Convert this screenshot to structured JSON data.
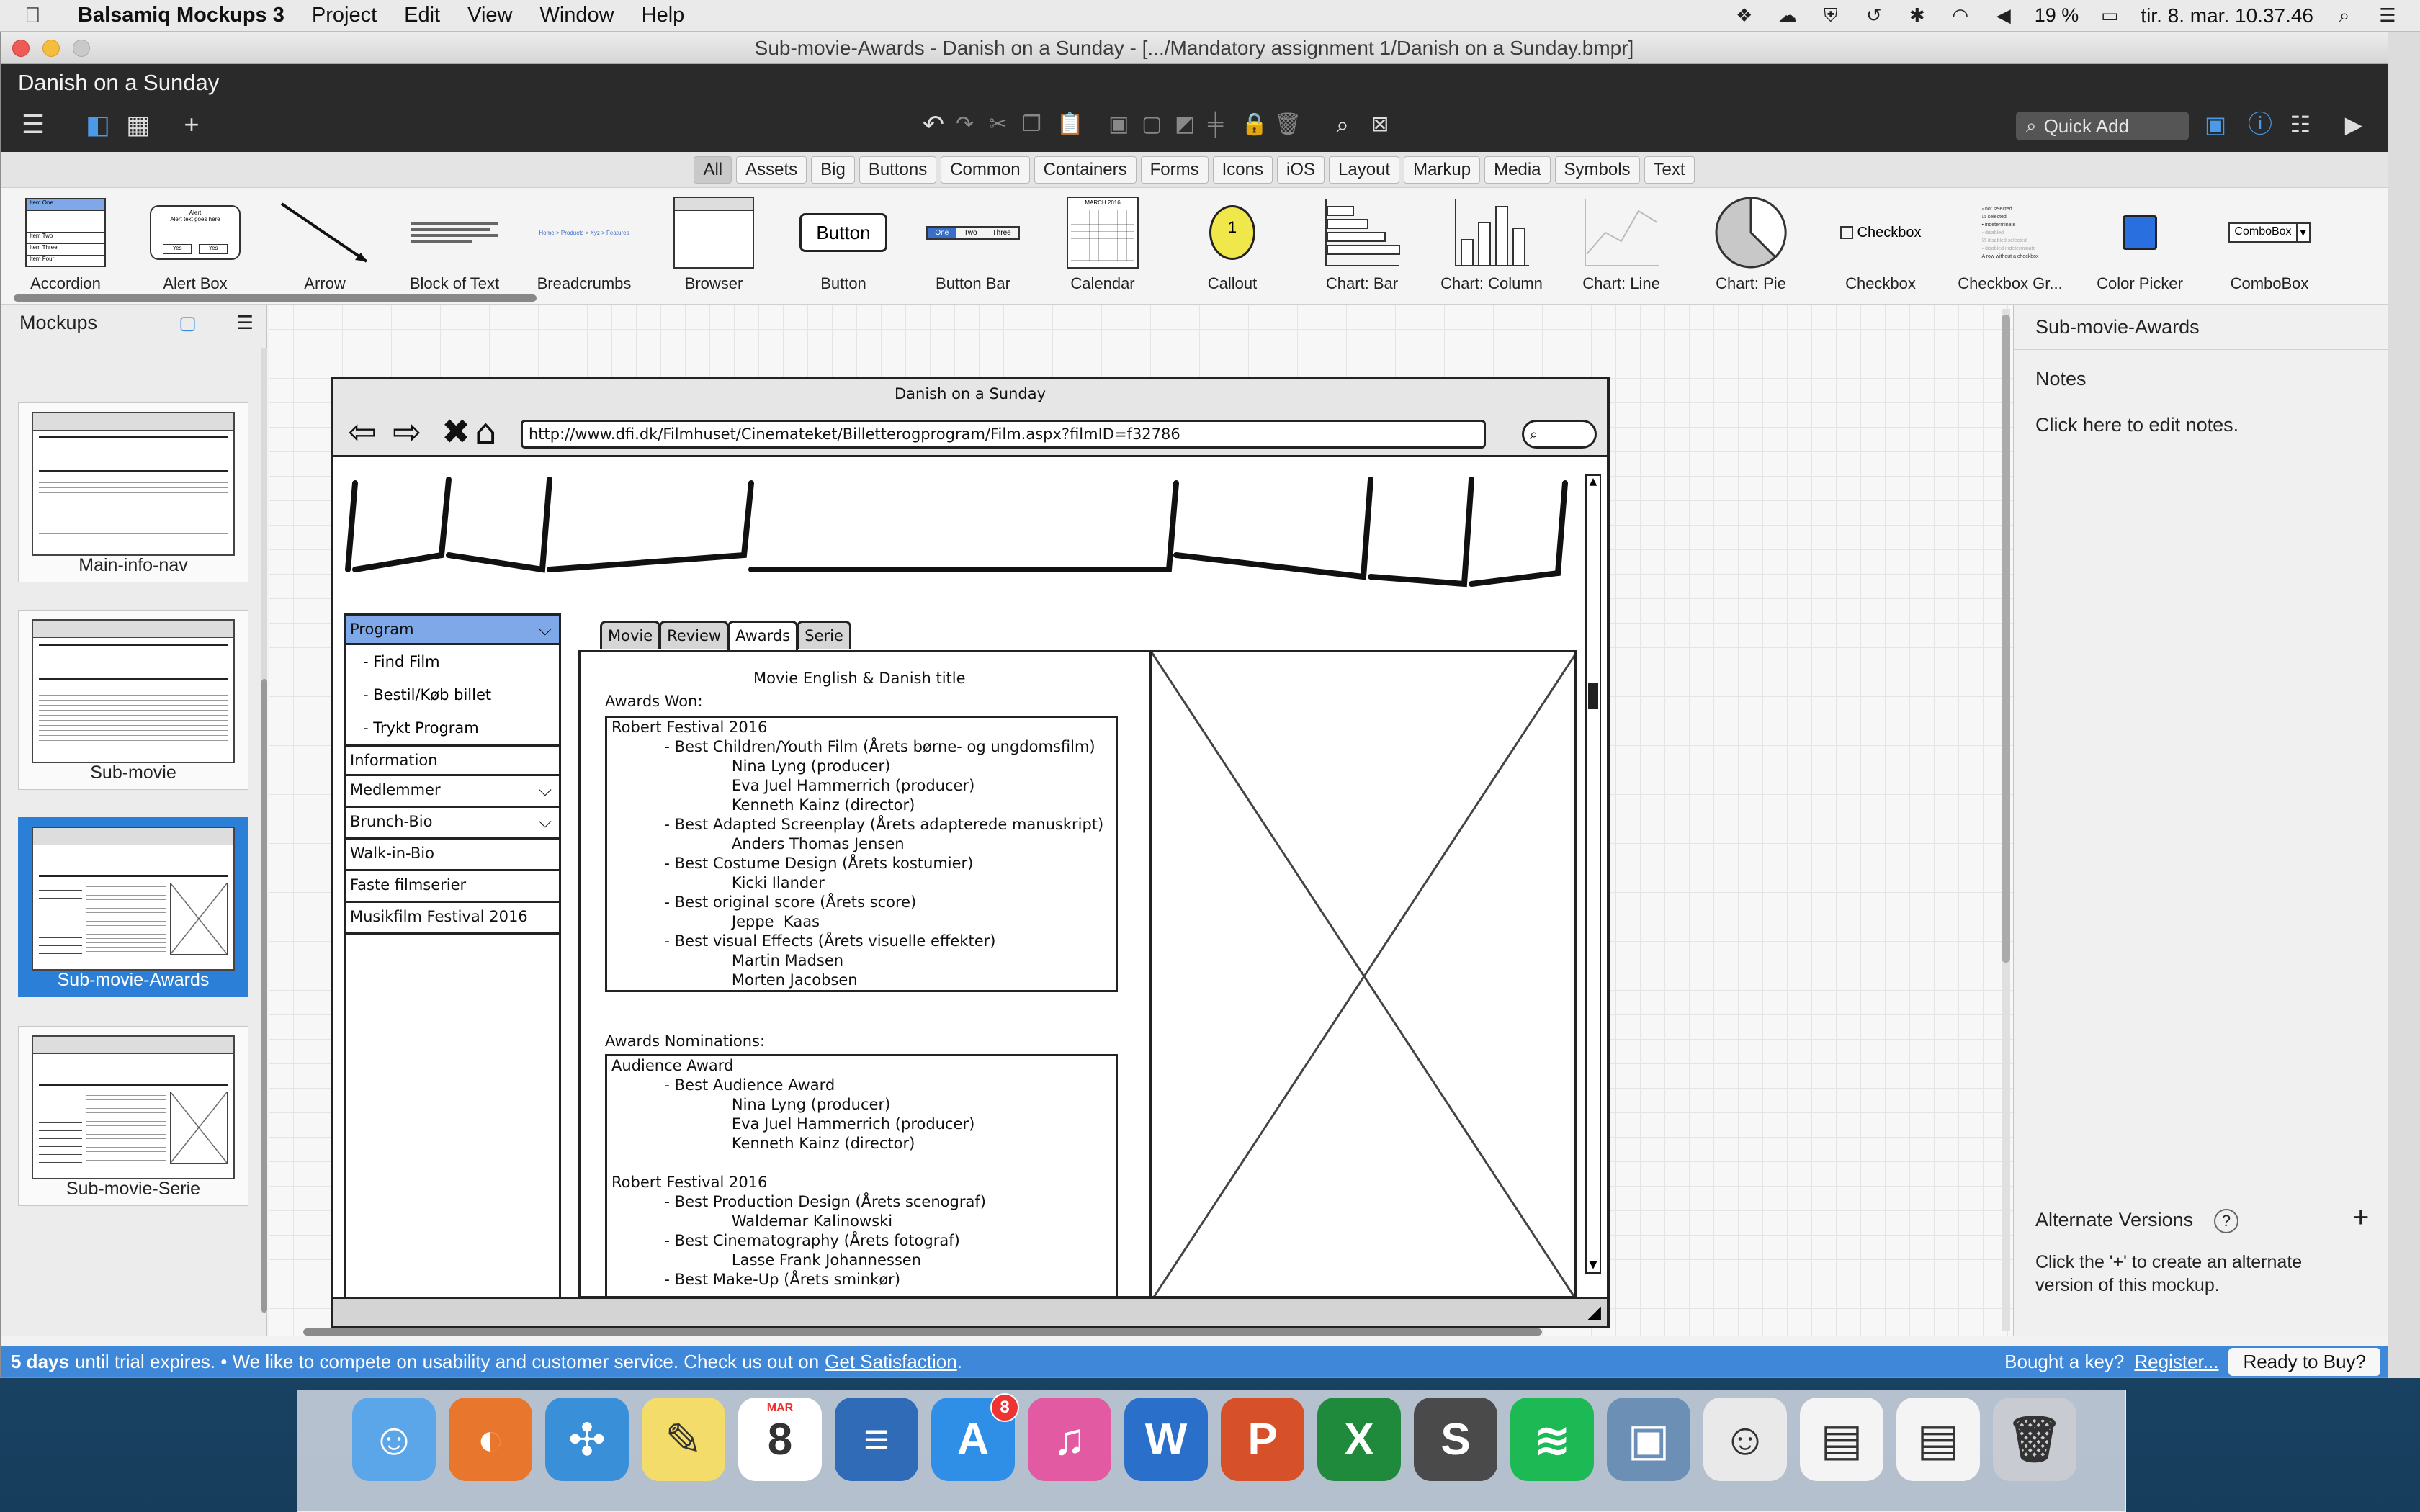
{
  "menubar": {
    "app": "Balsamiq Mockups 3",
    "items": [
      "Project",
      "Edit",
      "View",
      "Window",
      "Help"
    ],
    "battery": "19 %",
    "clock": "tir. 8. mar. 10.37.46"
  },
  "window": {
    "title": "Sub-movie-Awards - Danish on a Sunday - [.../Mandatory assignment 1/Danish on a Sunday.bmpr]",
    "project_name": "Danish on a Sunday",
    "quick_add_placeholder": "Quick Add"
  },
  "filters": [
    "All",
    "Assets",
    "Big",
    "Buttons",
    "Common",
    "Containers",
    "Forms",
    "Icons",
    "iOS",
    "Layout",
    "Markup",
    "Media",
    "Symbols",
    "Text"
  ],
  "filters_active": "All",
  "library": [
    {
      "label": "Accordion",
      "icon": "accordion-icon"
    },
    {
      "label": "Alert Box",
      "icon": "alert-box-icon"
    },
    {
      "label": "Arrow",
      "icon": "arrow-icon"
    },
    {
      "label": "Block of Text",
      "icon": "text-block-icon"
    },
    {
      "label": "Breadcrumbs",
      "icon": "breadcrumbs-icon"
    },
    {
      "label": "Browser",
      "icon": "browser-icon"
    },
    {
      "label": "Button",
      "icon": "button-icon"
    },
    {
      "label": "Button Bar",
      "icon": "button-bar-icon"
    },
    {
      "label": "Calendar",
      "icon": "calendar-icon"
    },
    {
      "label": "Callout",
      "icon": "callout-icon"
    },
    {
      "label": "Chart: Bar",
      "icon": "chart-bar-icon"
    },
    {
      "label": "Chart: Column",
      "icon": "chart-column-icon"
    },
    {
      "label": "Chart: Line",
      "icon": "chart-line-icon"
    },
    {
      "label": "Chart: Pie",
      "icon": "chart-pie-icon"
    },
    {
      "label": "Checkbox",
      "icon": "checkbox-icon"
    },
    {
      "label": "Checkbox Gr...",
      "icon": "checkbox-group-icon"
    },
    {
      "label": "Color Picker",
      "icon": "color-picker-icon"
    },
    {
      "label": "ComboBox",
      "icon": "combobox-icon"
    }
  ],
  "library_thumb_text": {
    "button": "Button",
    "checkbox": "Checkbox",
    "combobox": "ComboBox",
    "callout": "1",
    "calendar_month": "MARCH 2016",
    "alert_title": "Alert",
    "alert_text": "Alert text goes here",
    "alert_yes": "Yes",
    "alert_no": "Yes",
    "accordion_items": [
      "Item One",
      "Item Two",
      "Item Three",
      "Item Four"
    ],
    "button_bar": [
      "One",
      "Two",
      "Three"
    ],
    "breadcrumbs": "Home > Products > Xyz > Features",
    "checkbox_group": [
      "not selected",
      "selected",
      "indeterminate",
      "disabled",
      "disabled selected",
      "disabled indeterminate",
      "A row without a checkbox"
    ]
  },
  "mockups_panel": {
    "title": "Mockups",
    "items": [
      {
        "label": "Main-info-nav"
      },
      {
        "label": "Sub-movie"
      },
      {
        "label": "Sub-movie-Awards"
      },
      {
        "label": "Sub-movie-Serie"
      }
    ]
  },
  "mockup": {
    "browser_title": "Danish on a Sunday",
    "url": "http://www.dfi.dk/Filmhuset/Cinemateket/Billetterogprogram/Film.aspx?filmID=f32786",
    "nav": {
      "program": "Program",
      "sub": [
        "- Find Film",
        "- Bestil/Køb billet",
        "- Trykt Program"
      ],
      "items": [
        "Information",
        "Medlemmer",
        "Brunch-Bio",
        "Walk-in-Bio",
        "Faste filmserier",
        "Musikfilm Festival 2016"
      ]
    },
    "tabs": [
      "Movie",
      "Review",
      "Awards",
      "Serie"
    ],
    "tab_active": "Awards",
    "heading": "Movie English & Danish title",
    "awards_won_label": "Awards Won:",
    "awards_won": [
      "Robert Festival 2016",
      "           - Best Children/Youth Film (Årets børne- og ungdomsfilm)",
      "                         Nina Lyng (producer)",
      "                         Eva Juel Hammerrich (producer)",
      "                         Kenneth Kainz (director)",
      "           - Best Adapted Screenplay (Årets adapterede manuskript)",
      "                         Anders Thomas Jensen",
      "           - Best Costume Design (Årets kostumier)",
      "                         Kicki Ilander",
      "           - Best original score (Årets score)",
      "                         Jeppe  Kaas",
      "           - Best visual Effects (Årets visuelle effekter)",
      "                         Martin Madsen",
      "                         Morten Jacobsen"
    ],
    "awards_nom_label": "Awards Nominations:",
    "awards_nom": [
      "Audience Award",
      "           - Best Audience Award",
      "                         Nina Lyng (producer)",
      "                         Eva Juel Hammerrich (producer)",
      "                         Kenneth Kainz (director)",
      "",
      "Robert Festival 2016",
      "           - Best Production Design (Årets scenograf)",
      "                         Waldemar Kalinowski",
      "           - Best Cinematography (Årets fotograf)",
      "                         Lasse Frank Johannessen",
      "           - Best Make-Up (Årets sminkør)"
    ]
  },
  "right_panel": {
    "title": "Sub-movie-Awards",
    "notes_label": "Notes",
    "notes_text": "Click here to edit notes.",
    "alt_label": "Alternate Versions",
    "alt_help": "?",
    "alt_add": "+",
    "alt_text_1": "Click the '+' to create an alternate",
    "alt_text_2": "version of this mockup."
  },
  "trialbar": {
    "days": "5 days",
    "text": "until trial expires. • We like to compete on usability and customer service. Check us out on",
    "link": "Get Satisfaction",
    "link_end": ".",
    "bought": "Bought a key?",
    "register": "Register...",
    "ready": "Ready to Buy?"
  },
  "dock": [
    {
      "name": "finder-icon",
      "color": "#5aa6e8",
      "glyph": "☺"
    },
    {
      "name": "firefox-icon",
      "color": "#e8762c",
      "glyph": "◐"
    },
    {
      "name": "safari-icon",
      "color": "#3a90d8",
      "glyph": "✣"
    },
    {
      "name": "stickies-icon",
      "color": "#f3dc6a",
      "glyph": "✎"
    },
    {
      "name": "calendar-icon",
      "color": "#ffffff",
      "glyph": "8",
      "sub": "MAR"
    },
    {
      "name": "equalizer-icon",
      "color": "#2f6bb6",
      "glyph": "≡"
    },
    {
      "name": "app-store-icon",
      "color": "#2f8ee6",
      "glyph": "A",
      "badge": "8"
    },
    {
      "name": "itunes-icon",
      "color": "#e25aa2",
      "glyph": "♫"
    },
    {
      "name": "word-icon",
      "color": "#2a6fc9",
      "glyph": "W"
    },
    {
      "name": "powerpoint-icon",
      "color": "#d6502a",
      "glyph": "P"
    },
    {
      "name": "excel-icon",
      "color": "#1f8a3c",
      "glyph": "X"
    },
    {
      "name": "sublime-icon",
      "color": "#4a4a4a",
      "glyph": "S"
    },
    {
      "name": "spotify-icon",
      "color": "#1db954",
      "glyph": "≋"
    },
    {
      "name": "preview-icon",
      "color": "#6b8fb5",
      "glyph": "▣"
    },
    {
      "name": "balsamiq-icon",
      "color": "#e9e9e9",
      "glyph": "☺"
    },
    {
      "name": "document-icon",
      "color": "#f4f4f4",
      "glyph": "▤"
    },
    {
      "name": "document-icon-2",
      "color": "#f4f4f4",
      "glyph": "▤"
    },
    {
      "name": "trash-icon",
      "color": "#c8ccd2",
      "glyph": "🗑"
    }
  ]
}
